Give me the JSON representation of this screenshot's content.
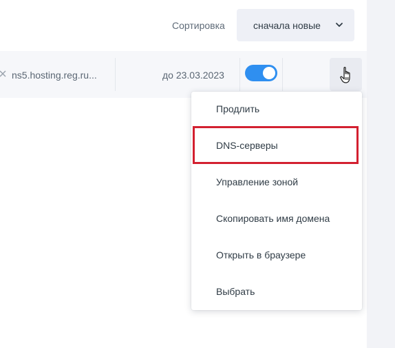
{
  "toolbar": {
    "sort_label": "Сортировка",
    "sort_value": "сначала новые"
  },
  "domain_row": {
    "nameservers": "ns5.hosting.reg.ru...",
    "expiry": "до 23.03.2023",
    "autorenew_enabled": true
  },
  "menu": {
    "items": [
      {
        "label": "Продлить"
      },
      {
        "label": "DNS-серверы",
        "highlighted": true
      },
      {
        "label": "Управление зоной"
      },
      {
        "label": "Скопировать имя домена"
      },
      {
        "label": "Открыть в браузере"
      },
      {
        "label": "Выбрать"
      }
    ]
  },
  "colors": {
    "accent": "#2f8ff0",
    "highlight": "#d32030",
    "select_bg": "#eef0f6",
    "row_bg": "#f6f7fa"
  },
  "icons": {
    "sort_chevron": "chevron-down-icon",
    "row_close": "close-icon",
    "cursor": "hand-pointer-icon"
  }
}
